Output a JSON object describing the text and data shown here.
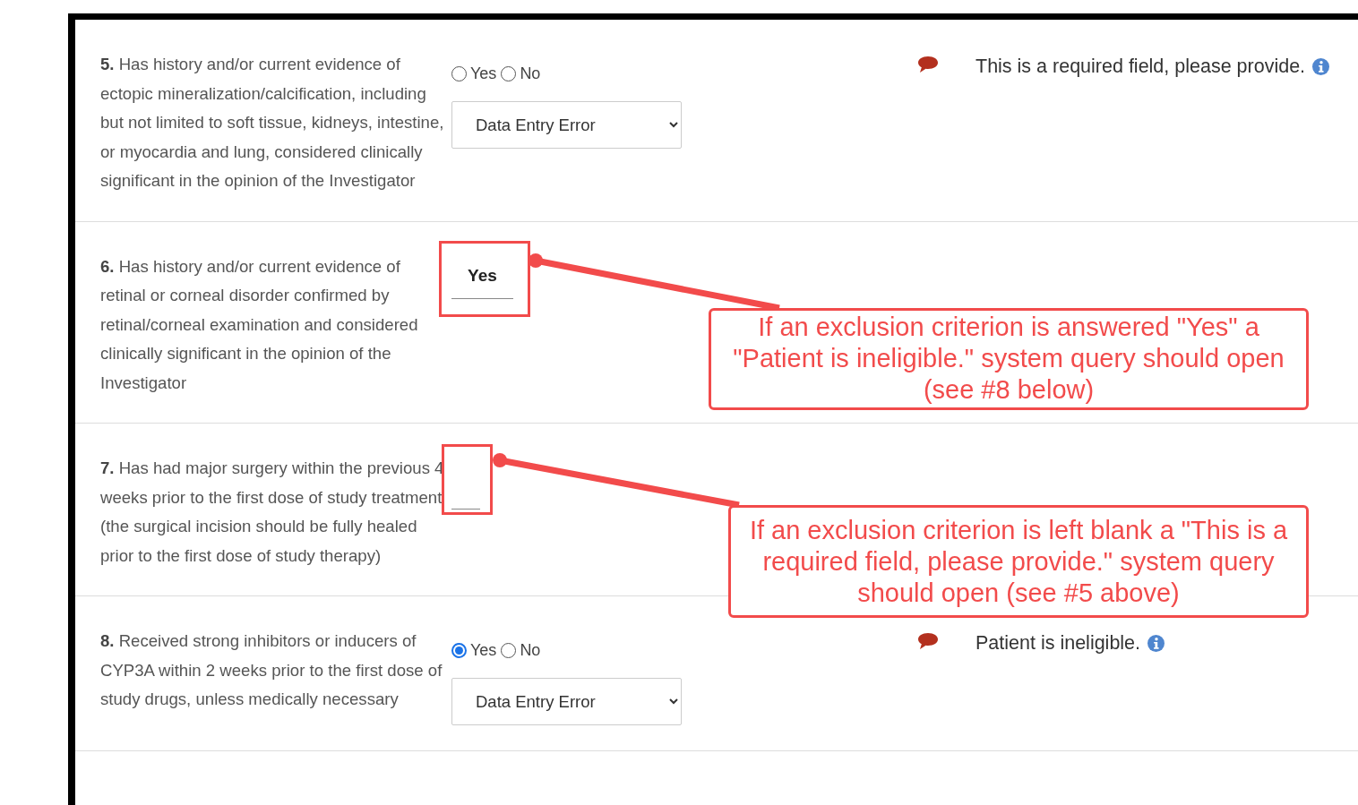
{
  "questions": [
    {
      "number": "5.",
      "text": "Has history and/or current evidence of ectopic mineralization/calcification, including but not limited to soft tissue, kidneys, intestine, or myocardia and lung, considered clinically significant in the opinion of the Investigator",
      "kind": "radio",
      "options": [
        {
          "label": "Yes",
          "selected": false
        },
        {
          "label": "No",
          "selected": false
        }
      ],
      "reason": "Data Entry Error",
      "query": "This is a required field, please provide."
    },
    {
      "number": "6.",
      "text": "Has history and/or current evidence of retinal or corneal disorder confirmed by retinal/corneal examination and considered clinically significant in the opinion of the Investigator",
      "kind": "display",
      "answer": "Yes",
      "annotation": "If an exclusion criterion is answered \"Yes\" a \"Patient is ineligible.\" system query should open (see #8 below)"
    },
    {
      "number": "7.",
      "text": "Has had major surgery within the previous 4 weeks prior to the first dose of study treatment (the surgical incision should be fully healed prior to the first dose of study therapy)",
      "kind": "display",
      "annotation": "If an exclusion criterion is left blank a \"This is a required field, please provide.\" system query should open (see #5 above)"
    },
    {
      "number": "8.",
      "text": "Received strong inhibitors or inducers of CYP3A within 2 weeks prior to the first dose of study drugs, unless medically necessary",
      "kind": "radio",
      "options": [
        {
          "label": "Yes",
          "selected": true
        },
        {
          "label": "No",
          "selected": false
        }
      ],
      "reason": "Data Entry Error",
      "query": "Patient is ineligible."
    }
  ]
}
